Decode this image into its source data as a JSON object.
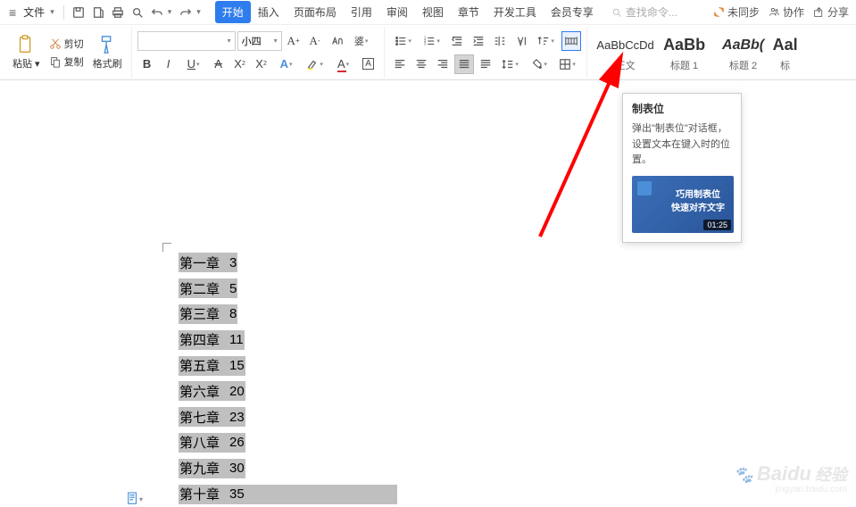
{
  "menubar": {
    "file_label": "文件",
    "search_placeholder": "查找命令...",
    "sync_status": "未同步",
    "collab": "协作",
    "share": "分享"
  },
  "tabs": [
    "开始",
    "插入",
    "页面布局",
    "引用",
    "审阅",
    "视图",
    "章节",
    "开发工具",
    "会员专享"
  ],
  "active_tab": 0,
  "ribbon": {
    "paste": "粘贴",
    "cut": "剪切",
    "copy": "复制",
    "format_painter": "格式刷",
    "font_name": "",
    "font_size": "小四"
  },
  "styles": [
    {
      "preview": "AaBbCcDd",
      "label": "正文",
      "cls": ""
    },
    {
      "preview": "AaBb",
      "label": "标题 1",
      "cls": "h1"
    },
    {
      "preview": "AaBb(",
      "label": "标题 2",
      "cls": "h2"
    },
    {
      "preview": "Aal",
      "label": "标",
      "cls": "h1"
    }
  ],
  "tooltip": {
    "title": "制表位",
    "desc": "弹出\"制表位\"对话框，设置文本在键入时的位置。",
    "video_line1": "巧用制表位",
    "video_line2": "快速对齐文字",
    "duration": "01:25"
  },
  "document": {
    "lines": [
      {
        "chapter": "第一章",
        "num": "3"
      },
      {
        "chapter": "第二章",
        "num": "5"
      },
      {
        "chapter": "第三章",
        "num": "8"
      },
      {
        "chapter": "第四章",
        "num": "11"
      },
      {
        "chapter": "第五章",
        "num": "15"
      },
      {
        "chapter": "第六章",
        "num": "20"
      },
      {
        "chapter": "第七章",
        "num": "23"
      },
      {
        "chapter": "第八章",
        "num": "26"
      },
      {
        "chapter": "第九章",
        "num": "30"
      },
      {
        "chapter": "第十章",
        "num": "35"
      }
    ]
  },
  "watermark": {
    "brand": "Baidu",
    "sub": "经验",
    "url": "jingyan.baidu.com"
  }
}
